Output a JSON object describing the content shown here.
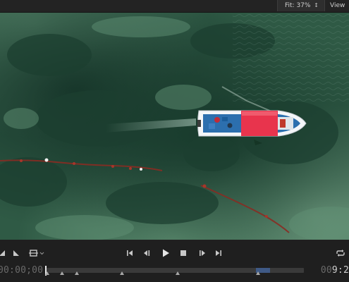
{
  "topbar": {
    "fit_label": "Fit: 37%",
    "view_label": "View"
  },
  "viewport": {
    "content": "aerial video frame of a boat on green water",
    "water_color": "#2f5a45",
    "boat_canopy_color": "#e8344d",
    "boat_hull_color": "#f4f6f8"
  },
  "transport": {
    "icons": [
      "mark-in-icon",
      "mark-out-icon",
      "safe-margins-icon",
      "go-to-start-icon",
      "step-back-icon",
      "play-icon",
      "stop-icon",
      "step-forward-icon",
      "go-to-end-icon",
      "loop-icon"
    ],
    "timecode_current": "00:00;00",
    "timecode_duration_lead": "00",
    "timecode_duration_tail": "9:2",
    "accent_color": "#3f5a86"
  }
}
